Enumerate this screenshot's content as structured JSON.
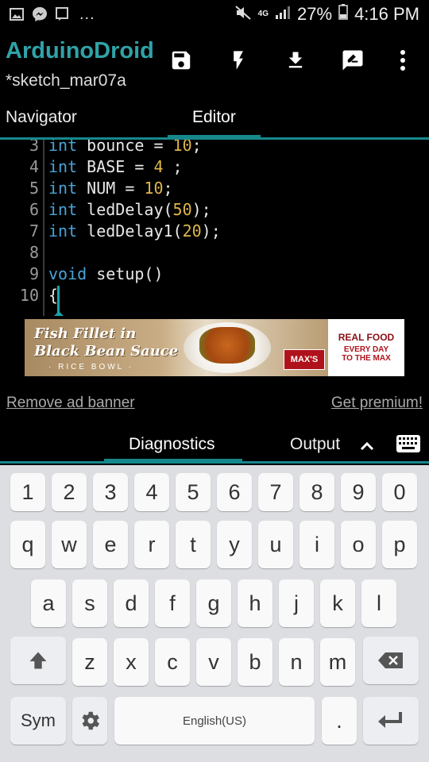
{
  "status_bar": {
    "icons": [
      "gallery-icon",
      "messenger-icon",
      "notification-icon"
    ],
    "more": "...",
    "network": "4G",
    "battery_percent": "27%",
    "time": "4:16 PM"
  },
  "app": {
    "title": "ArduinoDroid",
    "subtitle": "*sketch_mar07a",
    "tools": [
      "save-icon",
      "flash-icon",
      "download-icon",
      "edit-icon",
      "more-vert-icon"
    ]
  },
  "tabs": {
    "navigator": "Navigator",
    "editor": "Editor"
  },
  "editor": {
    "lines": [
      {
        "n": "3",
        "tokens": [
          {
            "t": "int",
            "c": "kw"
          },
          {
            "t": " bounce = ",
            "c": ""
          },
          {
            "t": "10",
            "c": "num"
          },
          {
            "t": ";",
            "c": ""
          }
        ]
      },
      {
        "n": "4",
        "tokens": [
          {
            "t": "int",
            "c": "kw"
          },
          {
            "t": " BASE = ",
            "c": ""
          },
          {
            "t": "4",
            "c": "num"
          },
          {
            "t": " ;",
            "c": ""
          }
        ]
      },
      {
        "n": "5",
        "tokens": [
          {
            "t": "int",
            "c": "kw"
          },
          {
            "t": " NUM = ",
            "c": ""
          },
          {
            "t": "10",
            "c": "num"
          },
          {
            "t": ";",
            "c": ""
          }
        ]
      },
      {
        "n": "6",
        "tokens": [
          {
            "t": "int",
            "c": "kw"
          },
          {
            "t": " ledDelay(",
            "c": ""
          },
          {
            "t": "50",
            "c": "num"
          },
          {
            "t": ");",
            "c": ""
          }
        ]
      },
      {
        "n": "7",
        "tokens": [
          {
            "t": "int",
            "c": "kw"
          },
          {
            "t": " ledDelay1(",
            "c": ""
          },
          {
            "t": "20",
            "c": "num"
          },
          {
            "t": ");",
            "c": ""
          }
        ]
      },
      {
        "n": "8",
        "tokens": []
      },
      {
        "n": "9",
        "tokens": [
          {
            "t": "void",
            "c": "kw"
          },
          {
            "t": " setup()",
            "c": ""
          }
        ]
      },
      {
        "n": "10",
        "tokens": [
          {
            "t": "{",
            "c": ""
          }
        ]
      }
    ]
  },
  "ad": {
    "line1": "Fish Fillet in",
    "line2": "Black Bean Sauce",
    "line3": "· RICE BOWL ·",
    "logo": "MAX'S",
    "right1": "REAL FOOD",
    "right2": "EVERY DAY",
    "right3": "TO THE MAX"
  },
  "links": {
    "remove_ad": "Remove ad banner",
    "premium": "Get premium!"
  },
  "bottom_tabs": {
    "diagnostics": "Diagnostics",
    "output": "Output"
  },
  "keyboard": {
    "row_numbers": [
      "1",
      "2",
      "3",
      "4",
      "5",
      "6",
      "7",
      "8",
      "9",
      "0"
    ],
    "row1": [
      "q",
      "w",
      "e",
      "r",
      "t",
      "y",
      "u",
      "i",
      "o",
      "p"
    ],
    "row2": [
      "a",
      "s",
      "d",
      "f",
      "g",
      "h",
      "j",
      "k",
      "l"
    ],
    "row3": [
      "z",
      "x",
      "c",
      "v",
      "b",
      "n",
      "m"
    ],
    "sym": "Sym",
    "space": "English(US)",
    "period": "."
  },
  "colors": {
    "accent": "#16888c",
    "title": "#2fa3a8",
    "keyword": "#4aa3d8",
    "number": "#e0b64b"
  }
}
